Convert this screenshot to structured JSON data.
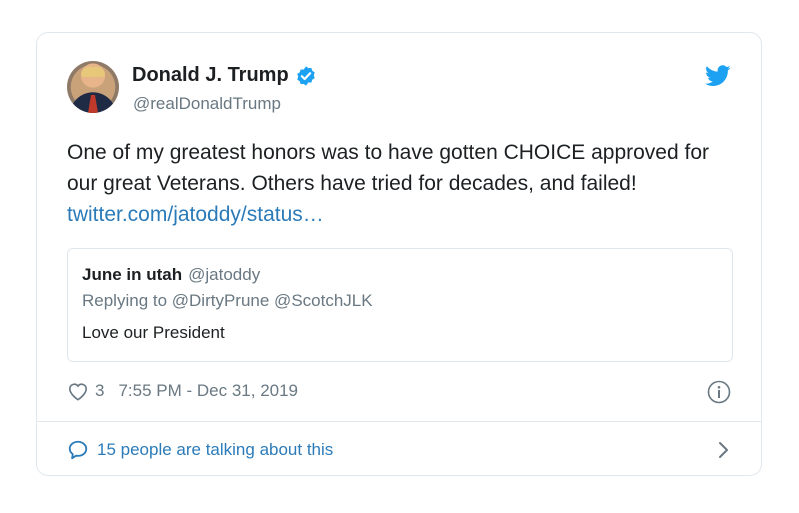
{
  "author": {
    "name": "Donald J. Trump",
    "handle": "@realDonaldTrump",
    "verified": true
  },
  "tweet": {
    "text_before_link": "One of my greatest honors was to have gotten CHOICE approved for our great Veterans. Others have tried for decades, and failed! ",
    "link_text": "twitter.com/jatoddy/status…"
  },
  "quoted": {
    "name": "June in utah",
    "handle": "@jatoddy",
    "replying_to": "Replying to @DirtyPrune @ScotchJLK",
    "text": "Love our President"
  },
  "meta": {
    "like_count": "3",
    "timestamp": "7:55 PM - Dec 31, 2019"
  },
  "footer": {
    "conversation_label": "15 people are talking about this"
  },
  "colors": {
    "link": "#2b7bb9",
    "twitter_blue": "#1da1f2",
    "secondary_text": "#697882",
    "border": "#e1e8ed"
  },
  "icons": [
    "twitter-bird-icon",
    "verified-badge-icon",
    "heart-icon",
    "info-icon",
    "speech-bubble-icon",
    "chevron-right-icon"
  ]
}
